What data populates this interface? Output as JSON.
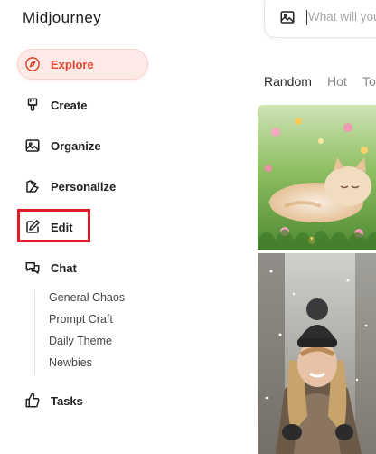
{
  "app": {
    "title": "Midjourney"
  },
  "sidebar": {
    "items": [
      {
        "label": "Explore",
        "icon": "compass-icon"
      },
      {
        "label": "Create",
        "icon": "brush-icon"
      },
      {
        "label": "Organize",
        "icon": "image-icon"
      },
      {
        "label": "Personalize",
        "icon": "palette-icon"
      },
      {
        "label": "Edit",
        "icon": "edit-icon"
      },
      {
        "label": "Chat",
        "icon": "chat-bubbles-icon"
      },
      {
        "label": "Tasks",
        "icon": "thumbs-up-icon"
      }
    ],
    "chat_channels": [
      "General Chaos",
      "Prompt Craft",
      "Daily Theme",
      "Newbies"
    ]
  },
  "search": {
    "placeholder": "What will you"
  },
  "feed": {
    "tabs": [
      "Random",
      "Hot",
      "To"
    ],
    "active_tab": "Random"
  },
  "colors": {
    "accent": "#e2472f",
    "accent_bg": "#fde9e6",
    "highlight_box": "#e01b2a"
  }
}
